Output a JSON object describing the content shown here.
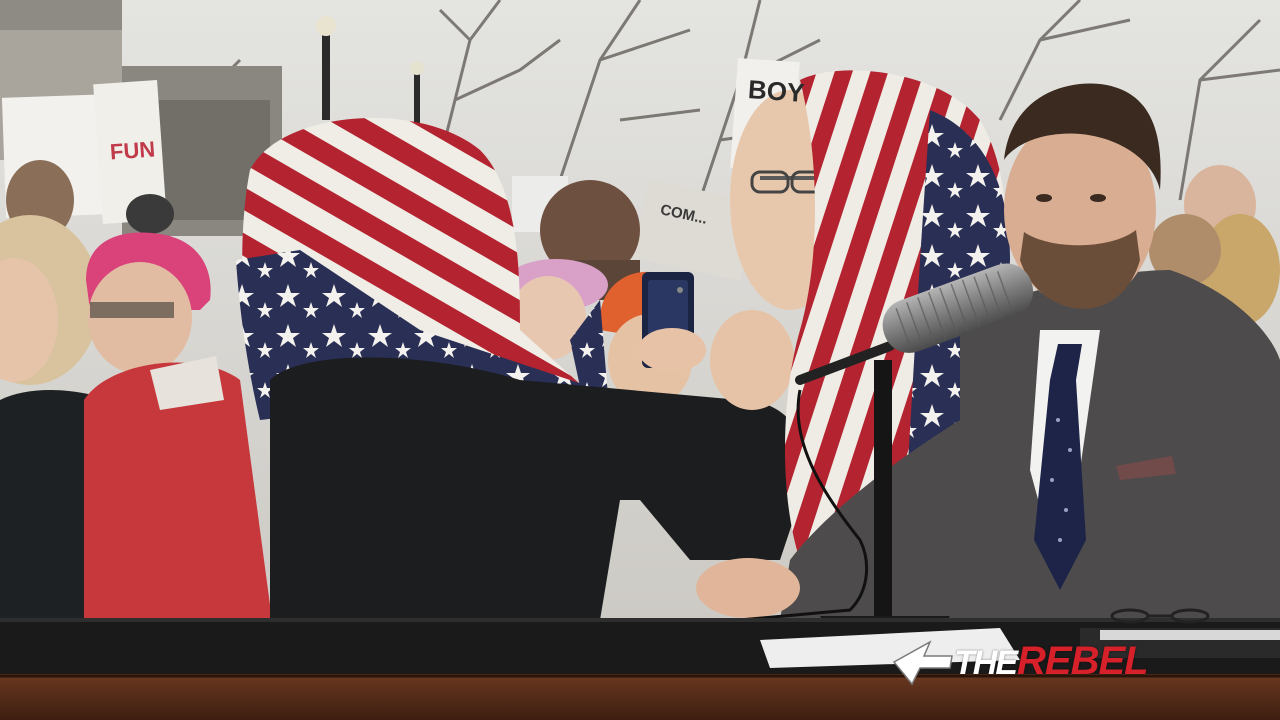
{
  "logo": {
    "the": "THE",
    "rebel": "REBEL",
    "brand_red": "#d6202a",
    "brand_white": "#ffffff"
  },
  "signs": {
    "left_sign_text": "FUN",
    "center_sign_text": "COM...",
    "right_sign_text": "BOY"
  },
  "colors": {
    "flag_red": "#b42430",
    "flag_white": "#f2efe8",
    "flag_blue": "#2a2f55",
    "desk_wood": "#5a2e1a",
    "desk_top": "#1c1c1c",
    "suit": "#4d4b4b",
    "sky": "#d9d9d6"
  }
}
